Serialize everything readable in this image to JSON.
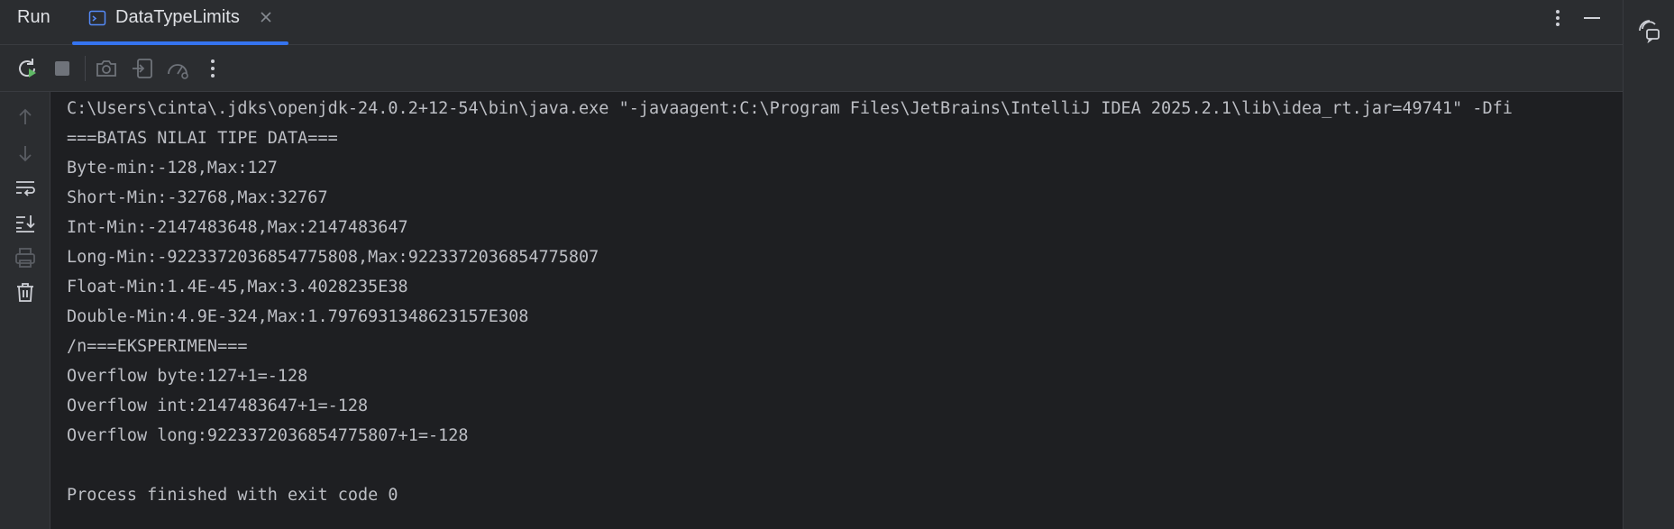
{
  "header": {
    "title": "Run",
    "tab_label": "DataTypeLimits",
    "icons": [
      "console-tab-icon",
      "close-icon",
      "more-vertical-icon",
      "minimize-icon"
    ]
  },
  "toolbar": {
    "icons": [
      "rerun-icon",
      "stop-icon",
      "screenshot-icon",
      "restore-layout-icon",
      "profiler-icon",
      "more-vertical-icon"
    ]
  },
  "gutter": {
    "icons": [
      "arrow-up-icon",
      "arrow-down-icon",
      "soft-wrap-icon",
      "scroll-to-end-icon",
      "print-icon",
      "trash-icon"
    ]
  },
  "right_strip": {
    "icons": [
      "ai-assistant-icon"
    ]
  },
  "console": {
    "lines": [
      "C:\\Users\\cinta\\.jdks\\openjdk-24.0.2+12-54\\bin\\java.exe \"-javaagent:C:\\Program Files\\JetBrains\\IntelliJ IDEA 2025.2.1\\lib\\idea_rt.jar=49741\" -Dfi",
      "===BATAS NILAI TIPE DATA===",
      "Byte-min:-128,Max:127",
      "Short-Min:-32768,Max:32767",
      "Int-Min:-2147483648,Max:2147483647",
      "Long-Min:-9223372036854775808,Max:9223372036854775807",
      "Float-Min:1.4E-45,Max:3.4028235E38",
      "Double-Min:4.9E-324,Max:1.7976931348623157E308",
      "/n===EKSPERIMEN===",
      "Overflow byte:127+1=-128",
      "Overflow int:2147483647+1=-128",
      "Overflow long:9223372036854775807+1=-128",
      "",
      "Process finished with exit code 0"
    ]
  },
  "colors": {
    "background": "#1e1f22",
    "panel": "#2b2d30",
    "text": "#bcbec4",
    "accent": "#3574f0",
    "rerun_green": "#5fb865"
  }
}
